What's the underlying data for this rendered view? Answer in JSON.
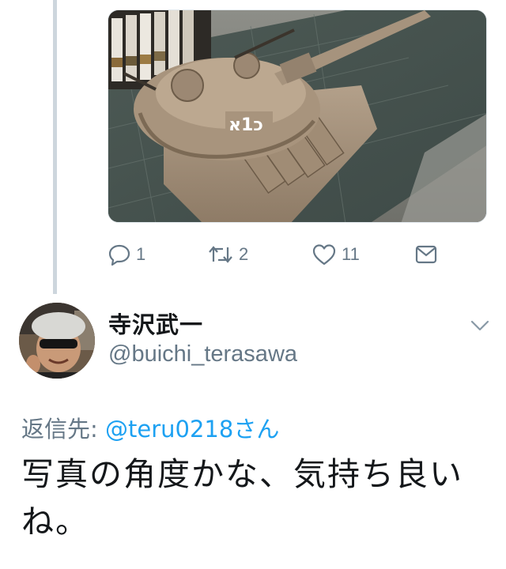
{
  "tweet_media": {
    "alt": "",
    "turret_marking": "כ1א"
  },
  "actions": {
    "reply_count": "1",
    "retweet_count": "2",
    "like_count": "11",
    "dm_icon": "envelope-icon",
    "reply_icon": "speech-bubble-icon",
    "retweet_icon": "retweet-arrows-icon",
    "like_icon": "heart-icon"
  },
  "reply": {
    "display_name": "寺沢武一",
    "handle": "@buichi_terasawa",
    "reply_to_label": "返信先: ",
    "reply_to_mention": "@teru0218さん",
    "text": "写真の角度かな、気持ち良いね。",
    "menu_icon": "chevron-down-icon"
  },
  "colors": {
    "accent": "#1da1f2",
    "muted": "#657786",
    "text": "#14171a",
    "thread_line": "#cdd6dd"
  }
}
